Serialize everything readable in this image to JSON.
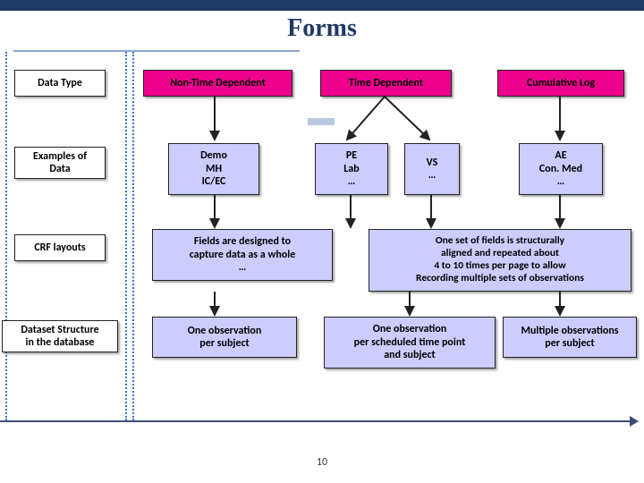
{
  "title": "Forms",
  "rowLabels": {
    "dataType": "Data Type",
    "examples": "Examples of\nData",
    "crf": "CRF layouts",
    "dataset": "Dataset Structure\nin the database"
  },
  "pills": {
    "nonTime": "Non-Time Dependent",
    "time": "Time Dependent",
    "cumlog": "Cumulative Log"
  },
  "examples": {
    "demo": "Demo\nMH\nIC/EC",
    "pe": "PE\nLab\n…",
    "vs": "VS\n…",
    "ae": "AE\nCon. Med\n…"
  },
  "crf": {
    "left": "Fields are designed to\ncapture data as a whole\n…",
    "right": "One set of fields is structurally\naligned and repeated about\n4 to 10 times per page to allow\nRecording multiple sets of observations"
  },
  "dataset": {
    "a": "One observation\nper subject",
    "b": "One observation\nper scheduled time point\nand subject",
    "c": "Multiple observations\nper subject"
  },
  "pageNumber": "10"
}
